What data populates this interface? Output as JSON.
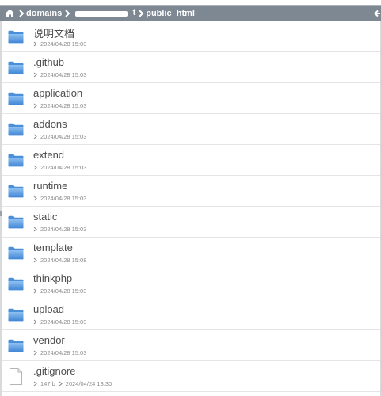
{
  "breadcrumb": {
    "home_icon": "home-icon",
    "items": [
      {
        "label": "domains"
      },
      {
        "label": "t"
      },
      {
        "label": "public_html"
      }
    ],
    "right_icon": "arrow-left-icon",
    "bar_color": "#7d8893"
  },
  "files": [
    {
      "name": "说明文档",
      "type": "folder",
      "modified": "2024/04/28 15:03"
    },
    {
      "name": ".github",
      "type": "folder",
      "modified": "2024/04/28 15:03"
    },
    {
      "name": "application",
      "type": "folder",
      "modified": "2024/04/28 15:03"
    },
    {
      "name": "addons",
      "type": "folder",
      "modified": "2024/04/28 15:03"
    },
    {
      "name": "extend",
      "type": "folder",
      "modified": "2024/04/28 15:03"
    },
    {
      "name": "runtime",
      "type": "folder",
      "modified": "2024/04/28 15:03"
    },
    {
      "name": "static",
      "type": "folder",
      "modified": "2024/04/28 15:03"
    },
    {
      "name": "template",
      "type": "folder",
      "modified": "2024/04/28 15:08"
    },
    {
      "name": "thinkphp",
      "type": "folder",
      "modified": "2024/04/28 15:03"
    },
    {
      "name": "upload",
      "type": "folder",
      "modified": "2024/04/28 15:03"
    },
    {
      "name": "vendor",
      "type": "folder",
      "modified": "2024/04/28 15:03"
    },
    {
      "name": ".gitignore",
      "type": "file",
      "size": "147 b",
      "modified": "2024/04/24 13:30"
    }
  ],
  "icons": {
    "folder": "folder-icon",
    "file": "file-icon",
    "folder_color": "#5b9bdf"
  }
}
